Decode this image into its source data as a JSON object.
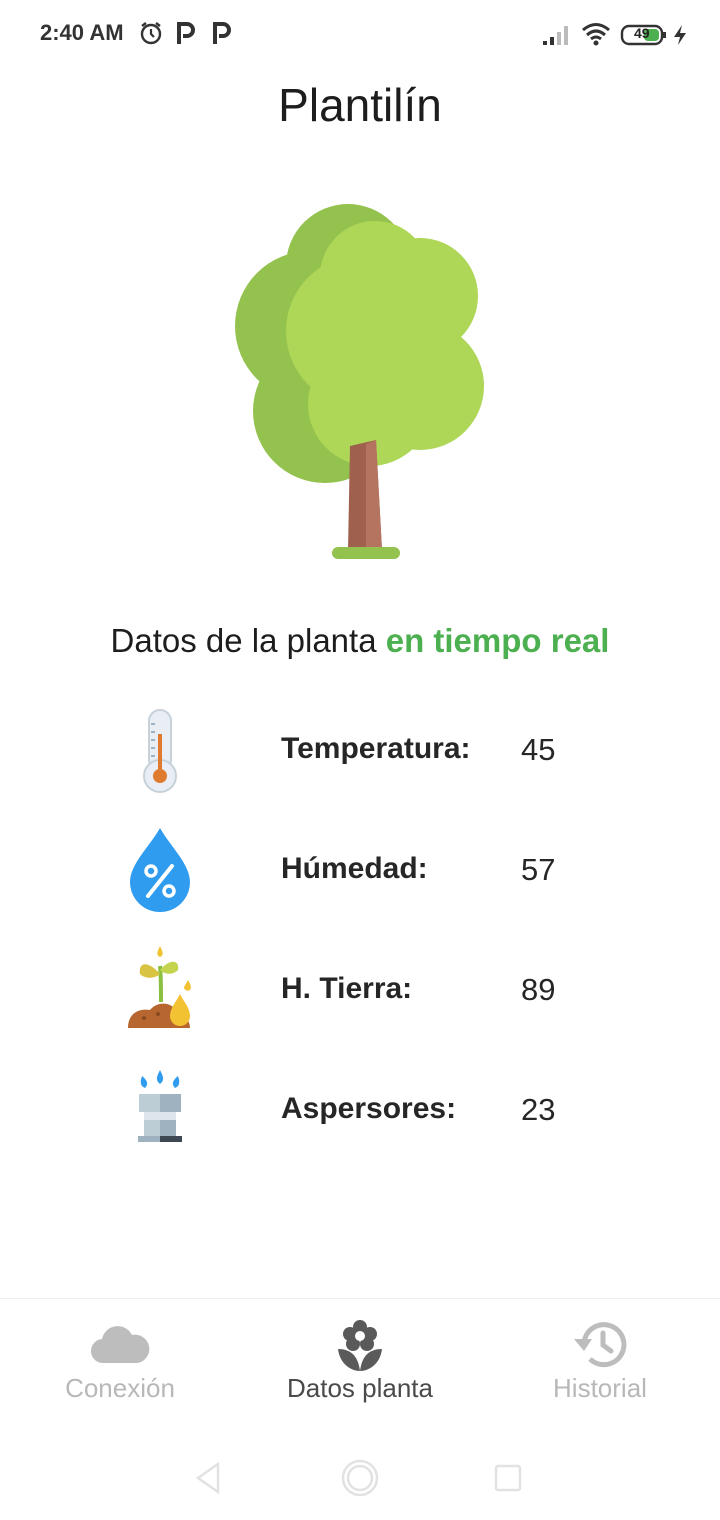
{
  "status_bar": {
    "time": "2:40 AM",
    "battery": "49",
    "icons": [
      "alarm-icon",
      "parking-p-icon",
      "parking-p-icon",
      "signal-icon",
      "wifi-icon",
      "battery-icon",
      "charging-icon"
    ]
  },
  "app": {
    "title": "Plantilín"
  },
  "section": {
    "title_prefix": "Datos de la planta ",
    "title_accent": "en tiempo real"
  },
  "readings": [
    {
      "label": "Temperatura:",
      "value": "45",
      "icon": "thermometer-icon"
    },
    {
      "label": "Húmedad:",
      "value": "57",
      "icon": "humidity-drop-icon"
    },
    {
      "label": "H. Tierra:",
      "value": "89",
      "icon": "soil-sprout-icon"
    },
    {
      "label": "Aspersores:",
      "value": "23",
      "icon": "sprinkler-icon"
    }
  ],
  "bottom_nav": {
    "items": [
      {
        "label": "Conexión",
        "icon": "cloud-icon",
        "active": false
      },
      {
        "label": "Datos planta",
        "icon": "flower-icon",
        "active": true
      },
      {
        "label": "Historial",
        "icon": "history-icon",
        "active": false
      }
    ]
  },
  "colors": {
    "accent": "#4caf50",
    "inactive_nav": "#b8b8b8",
    "active_nav": "#4a4a4a",
    "tree_light": "#aed657",
    "tree_dark": "#93c24e",
    "trunk": "#a0604e"
  }
}
